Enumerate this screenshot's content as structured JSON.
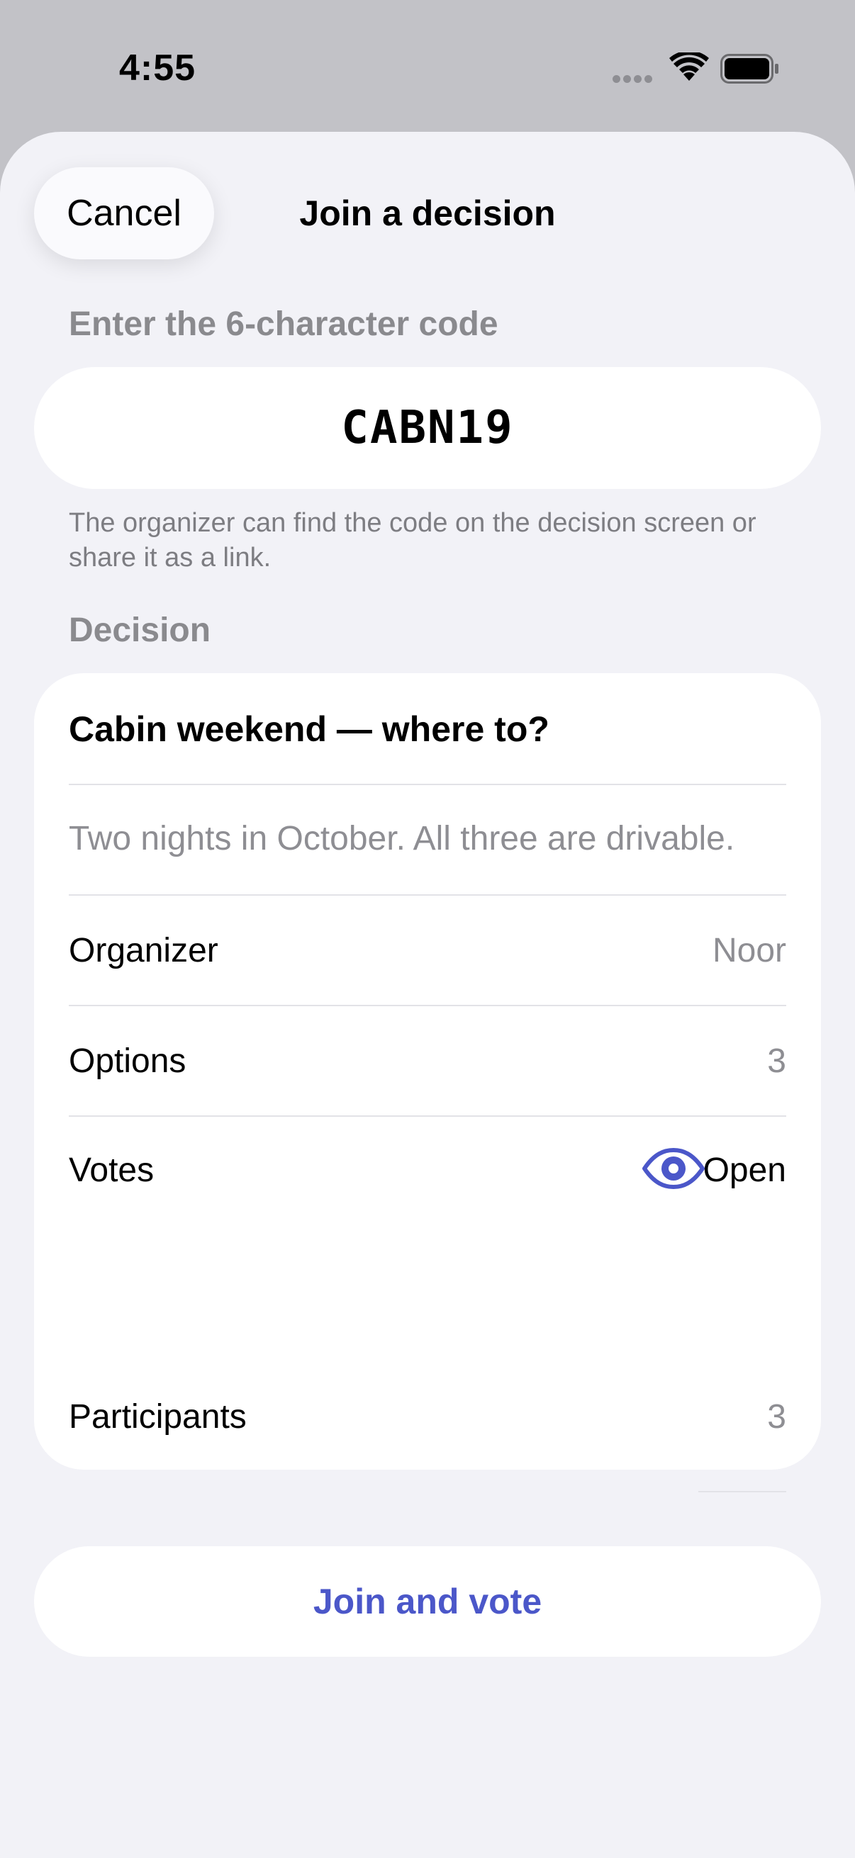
{
  "status_bar": {
    "time": "4:55"
  },
  "sheet": {
    "title": "Join a decision",
    "cancel_label": "Cancel"
  },
  "code_section": {
    "label": "Enter the 6-character code",
    "code_value": "CABN19",
    "hint": "The organizer can find the code on the decision screen or share it as a link."
  },
  "decision": {
    "section_label": "Decision",
    "title": "Cabin weekend — where to?",
    "description": "Two nights in October. All three are drivable.",
    "rows": {
      "organizer": {
        "label": "Organizer",
        "value": "Noor"
      },
      "options": {
        "label": "Options",
        "value": "3"
      },
      "votes": {
        "label": "Votes",
        "value": "Open",
        "icon": "eye-icon"
      },
      "participants": {
        "label": "Participants",
        "value": "3"
      }
    }
  },
  "join_button_label": "Join and vote",
  "colors": {
    "accent": "#4b57c9",
    "sheet_background": "#f2f2f7",
    "card_background": "#ffffff",
    "secondary_text": "#8e8e93"
  }
}
